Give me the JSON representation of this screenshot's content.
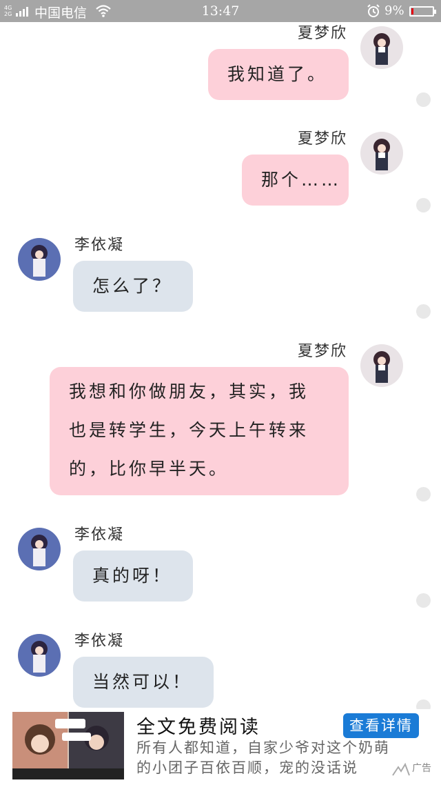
{
  "status_bar": {
    "network": [
      "4G",
      "2G"
    ],
    "carrier": "中国电信",
    "time": "13:47",
    "battery": "9%",
    "battery_level": 0.09,
    "battery_color": "#e60012",
    "icons": [
      "signal-icon",
      "wifi-icon",
      "alarm-icon",
      "battery-icon"
    ]
  },
  "colors": {
    "outgoing_bubble": "#fdd0d9",
    "incoming_bubble": "#dde4ec",
    "ad_button": "#1a7bd6"
  },
  "messages": [
    {
      "sender": "夏梦欣",
      "side": "right",
      "text": "我知道了。"
    },
    {
      "sender": "夏梦欣",
      "side": "right",
      "text": "那个……"
    },
    {
      "sender": "李依凝",
      "side": "left",
      "text": "怎么了？"
    },
    {
      "sender": "夏梦欣",
      "side": "right",
      "lines": [
        "我想和你做朋友，其实，我",
        "也是转学生，今天上午转来",
        "的，比你早半天。"
      ]
    },
    {
      "sender": "李依凝",
      "side": "left",
      "text": "真的呀！"
    },
    {
      "sender": "李依凝",
      "side": "left",
      "text": "当然可以！"
    }
  ],
  "ad": {
    "title": "全文免费阅读",
    "button": "查看详情",
    "description": [
      "所有人都知道，自家少爷对这个奶萌",
      "的小团子百依百顺，宠的没话说"
    ],
    "tag": "广告"
  }
}
